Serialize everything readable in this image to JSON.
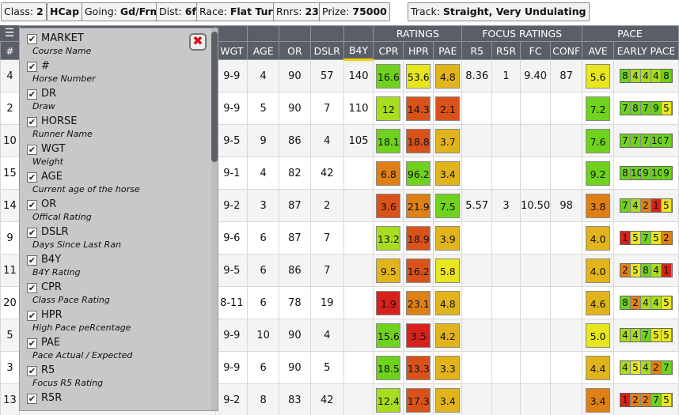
{
  "info_bar": [
    {
      "label": "Class:",
      "value": "2"
    },
    {
      "label": "",
      "value": "HCap"
    },
    {
      "label": "Going:",
      "value": "Gd/Frm"
    },
    {
      "label": "Dist:",
      "value": "6f"
    },
    {
      "label": "Race:",
      "value": "Flat Turf"
    },
    {
      "label": "Rnrs:",
      "value": "23"
    },
    {
      "label": "Prize:",
      "value": "75000"
    },
    {
      "label": "Track:",
      "value": "Straight, Very Undulating"
    }
  ],
  "groups": {
    "ratings": "RATINGS",
    "focus": "FOCUS RATINGS",
    "pace": "PACE"
  },
  "columns": {
    "num": "#",
    "wgt": "WGT",
    "age": "AGE",
    "or": "OR",
    "dslr": "DSLR",
    "b4y": "B4Y",
    "cpr": "CPR",
    "hpr": "HPR",
    "pae": "PAE",
    "r5": "R5",
    "r5r": "R5R",
    "fc": "FC",
    "conf": "CONF",
    "ave": "AVE",
    "early_pace": "EARLY PACE"
  },
  "colors": {
    "green": "#6fd21c",
    "lightgreen": "#a8dc1e",
    "yellow": "#e8e61e",
    "gold": "#e2b41c",
    "orange": "#df8016",
    "redorange": "#d9521a",
    "red": "#d7221b"
  },
  "column_chooser": {
    "menu_icon": "☰",
    "close_icon": "✖",
    "items": [
      {
        "label": "MARKET",
        "desc": "Course Name"
      },
      {
        "label": "#",
        "desc": "Horse Number"
      },
      {
        "label": "DR",
        "desc": "Draw"
      },
      {
        "label": "HORSE",
        "desc": "Runner Name"
      },
      {
        "label": "WGT",
        "desc": "Weight"
      },
      {
        "label": "AGE",
        "desc": "Current age of the horse"
      },
      {
        "label": "OR",
        "desc": "Offical Rating"
      },
      {
        "label": "DSLR",
        "desc": "Days Since Last Ran"
      },
      {
        "label": "B4Y",
        "desc": "B4Y Rating"
      },
      {
        "label": "CPR",
        "desc": "Class Pace Rating"
      },
      {
        "label": "HPR",
        "desc": "High Pace peRcentage"
      },
      {
        "label": "PAE",
        "desc": "Pace Actual / Expected"
      },
      {
        "label": "R5",
        "desc": "Focus R5 Rating"
      },
      {
        "label": "R5R",
        "desc": ""
      }
    ]
  },
  "rows": [
    {
      "num": "4",
      "wgt": "9-9",
      "age": "4",
      "or": "90",
      "dslr": "57",
      "b4y": "140",
      "cpr": {
        "v": "16.6",
        "c": "#6fd21c"
      },
      "hpr": {
        "v": "53.6",
        "c": "#e8e61e"
      },
      "pae": {
        "v": "4.8",
        "c": "#e2b41c"
      },
      "r5": "8.36",
      "r5r": "1",
      "fc": "9.40",
      "conf": "87",
      "ave": {
        "v": "5.6",
        "c": "#e8e61e"
      },
      "ep": [
        [
          "8",
          "#6fd21c"
        ],
        [
          "4",
          "#a8dc1e"
        ],
        [
          "4",
          "#a8dc1e"
        ],
        [
          "4",
          "#a8dc1e"
        ],
        [
          "8",
          "#6fd21c"
        ]
      ]
    },
    {
      "num": "2",
      "wgt": "9-9",
      "age": "5",
      "or": "90",
      "dslr": "7",
      "b4y": "110",
      "cpr": {
        "v": "12",
        "c": "#a8dc1e"
      },
      "hpr": {
        "v": "14.3",
        "c": "#d9521a"
      },
      "pae": {
        "v": "2.1",
        "c": "#d9521a"
      },
      "r5": "",
      "r5r": "",
      "fc": "",
      "conf": "",
      "ave": {
        "v": "7.2",
        "c": "#6fd21c"
      },
      "ep": [
        [
          "7",
          "#6fd21c"
        ],
        [
          "8",
          "#6fd21c"
        ],
        [
          "7",
          "#6fd21c"
        ],
        [
          "9",
          "#6fd21c"
        ],
        [
          "5",
          "#e8e61e"
        ]
      ]
    },
    {
      "num": "10",
      "wgt": "9-5",
      "age": "9",
      "or": "86",
      "dslr": "4",
      "b4y": "105",
      "cpr": {
        "v": "18.1",
        "c": "#6fd21c"
      },
      "hpr": {
        "v": "18.8",
        "c": "#d9521a"
      },
      "pae": {
        "v": "3.7",
        "c": "#e2b41c"
      },
      "r5": "",
      "r5r": "",
      "fc": "",
      "conf": "",
      "ave": {
        "v": "7.6",
        "c": "#6fd21c"
      },
      "ep": [
        [
          "7",
          "#6fd21c"
        ],
        [
          "7",
          "#6fd21c"
        ],
        [
          "7",
          "#6fd21c"
        ],
        [
          "10",
          "#6fd21c"
        ],
        [
          "7",
          "#6fd21c"
        ]
      ]
    },
    {
      "num": "15",
      "wgt": "9-1",
      "age": "4",
      "or": "82",
      "dslr": "42",
      "b4y": "",
      "cpr": {
        "v": "6.8",
        "c": "#df8016"
      },
      "hpr": {
        "v": "96.2",
        "c": "#6fd21c"
      },
      "pae": {
        "v": "3.4",
        "c": "#e2b41c"
      },
      "r5": "",
      "r5r": "",
      "fc": "",
      "conf": "",
      "ave": {
        "v": "9.2",
        "c": "#6fd21c"
      },
      "ep": [
        [
          "8",
          "#6fd21c"
        ],
        [
          "10",
          "#6fd21c"
        ],
        [
          "9",
          "#6fd21c"
        ],
        [
          "10",
          "#6fd21c"
        ],
        [
          "9",
          "#6fd21c"
        ]
      ]
    },
    {
      "num": "14",
      "wgt": "9-2",
      "age": "3",
      "or": "87",
      "dslr": "2",
      "b4y": "",
      "cpr": {
        "v": "3.6",
        "c": "#d9521a"
      },
      "hpr": {
        "v": "21.9",
        "c": "#df8016"
      },
      "pae": {
        "v": "7.5",
        "c": "#6fd21c"
      },
      "r5": "5.57",
      "r5r": "3",
      "fc": "10.50",
      "conf": "98",
      "ave": {
        "v": "3.8",
        "c": "#df8016"
      },
      "ep": [
        [
          "7",
          "#6fd21c"
        ],
        [
          "4",
          "#a8dc1e"
        ],
        [
          "2",
          "#df8016"
        ],
        [
          "1",
          "#d7221b"
        ],
        [
          "5",
          "#e8e61e"
        ]
      ]
    },
    {
      "num": "9",
      "wgt": "9-6",
      "age": "6",
      "or": "87",
      "dslr": "7",
      "b4y": "",
      "cpr": {
        "v": "13.2",
        "c": "#a8dc1e"
      },
      "hpr": {
        "v": "18.9",
        "c": "#d9521a"
      },
      "pae": {
        "v": "3.9",
        "c": "#e2b41c"
      },
      "r5": "",
      "r5r": "",
      "fc": "",
      "conf": "",
      "ave": {
        "v": "4.0",
        "c": "#e2b41c"
      },
      "ep": [
        [
          "1",
          "#d7221b"
        ],
        [
          "5",
          "#e8e61e"
        ],
        [
          "7",
          "#6fd21c"
        ],
        [
          "5",
          "#e8e61e"
        ],
        [
          "2",
          "#df8016"
        ]
      ]
    },
    {
      "num": "11",
      "wgt": "9-5",
      "age": "6",
      "or": "86",
      "dslr": "7",
      "b4y": "",
      "cpr": {
        "v": "9.5",
        "c": "#e2b41c"
      },
      "hpr": {
        "v": "16.2",
        "c": "#d9521a"
      },
      "pae": {
        "v": "5.8",
        "c": "#e8e61e"
      },
      "r5": "",
      "r5r": "",
      "fc": "",
      "conf": "",
      "ave": {
        "v": "4.0",
        "c": "#e2b41c"
      },
      "ep": [
        [
          "2",
          "#df8016"
        ],
        [
          "5",
          "#e8e61e"
        ],
        [
          "8",
          "#6fd21c"
        ],
        [
          "4",
          "#a8dc1e"
        ],
        [
          "1",
          "#d7221b"
        ]
      ]
    },
    {
      "num": "20",
      "wgt": "8-11",
      "age": "6",
      "or": "78",
      "dslr": "19",
      "b4y": "",
      "cpr": {
        "v": "1.9",
        "c": "#d7221b"
      },
      "hpr": {
        "v": "23.1",
        "c": "#df8016"
      },
      "pae": {
        "v": "4.8",
        "c": "#e2b41c"
      },
      "r5": "",
      "r5r": "",
      "fc": "",
      "conf": "",
      "ave": {
        "v": "4.6",
        "c": "#e2b41c"
      },
      "ep": [
        [
          "8",
          "#6fd21c"
        ],
        [
          "2",
          "#df8016"
        ],
        [
          "4",
          "#a8dc1e"
        ],
        [
          "4",
          "#a8dc1e"
        ],
        [
          "5",
          "#e8e61e"
        ]
      ]
    },
    {
      "num": "5",
      "wgt": "9-9",
      "age": "10",
      "or": "90",
      "dslr": "4",
      "b4y": "",
      "cpr": {
        "v": "15.6",
        "c": "#6fd21c"
      },
      "hpr": {
        "v": "3.5",
        "c": "#d7221b"
      },
      "pae": {
        "v": "4.2",
        "c": "#e2b41c"
      },
      "r5": "",
      "r5r": "",
      "fc": "",
      "conf": "",
      "ave": {
        "v": "5.0",
        "c": "#e8e61e"
      },
      "ep": [
        [
          "4",
          "#a8dc1e"
        ],
        [
          "4",
          "#a8dc1e"
        ],
        [
          "7",
          "#6fd21c"
        ],
        [
          "5",
          "#e8e61e"
        ],
        [
          "5",
          "#e8e61e"
        ]
      ]
    },
    {
      "num": "3",
      "wgt": "9-9",
      "age": "6",
      "or": "90",
      "dslr": "5",
      "b4y": "",
      "cpr": {
        "v": "18.5",
        "c": "#6fd21c"
      },
      "hpr": {
        "v": "13.3",
        "c": "#d9521a"
      },
      "pae": {
        "v": "3.3",
        "c": "#e2b41c"
      },
      "r5": "",
      "r5r": "",
      "fc": "",
      "conf": "",
      "ave": {
        "v": "4.4",
        "c": "#e2b41c"
      },
      "ep": [
        [
          "4",
          "#a8dc1e"
        ],
        [
          "5",
          "#e8e61e"
        ],
        [
          "4",
          "#a8dc1e"
        ],
        [
          "2",
          "#df8016"
        ],
        [
          "7",
          "#6fd21c"
        ]
      ]
    },
    {
      "num": "13",
      "wgt": "9-2",
      "age": "8",
      "or": "83",
      "dslr": "42",
      "b4y": "",
      "cpr": {
        "v": "12.4",
        "c": "#a8dc1e"
      },
      "hpr": {
        "v": "17.3",
        "c": "#d9521a"
      },
      "pae": {
        "v": "3.4",
        "c": "#e2b41c"
      },
      "r5": "",
      "r5r": "",
      "fc": "",
      "conf": "",
      "ave": {
        "v": "3.4",
        "c": "#df8016"
      },
      "ep": [
        [
          "1",
          "#d7221b"
        ],
        [
          "2",
          "#df8016"
        ],
        [
          "2",
          "#df8016"
        ],
        [
          "7",
          "#6fd21c"
        ],
        [
          "5",
          "#e8e61e"
        ]
      ]
    }
  ]
}
